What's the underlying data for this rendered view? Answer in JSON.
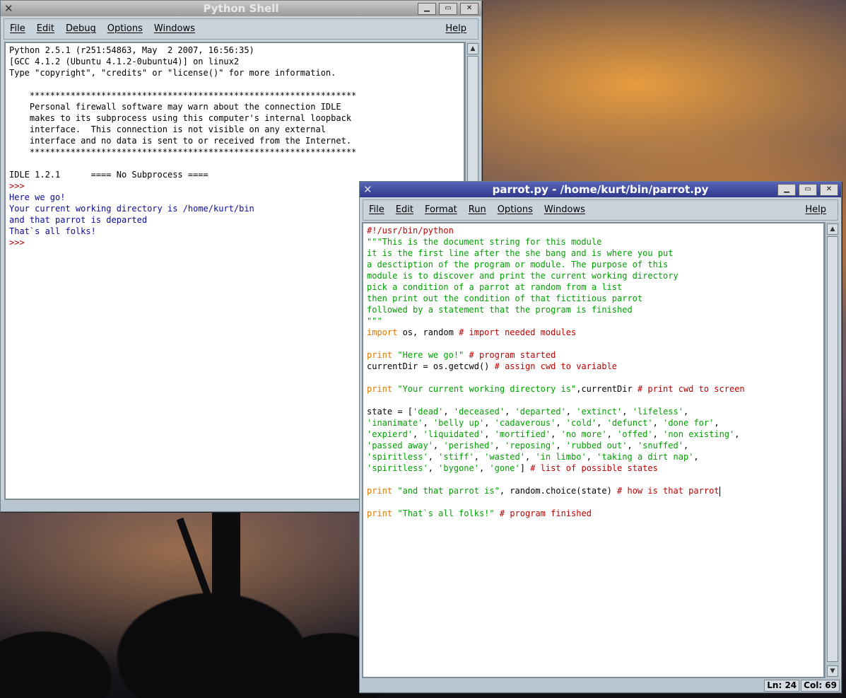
{
  "shell": {
    "title": "Python Shell",
    "menu": [
      "File",
      "Edit",
      "Debug",
      "Options",
      "Windows"
    ],
    "help": "Help",
    "lines": [
      {
        "t": "Python 2.5.1 (r251:54863, May  2 2007, 16:56:35)",
        "c": "norm"
      },
      {
        "t": "[GCC 4.1.2 (Ubuntu 4.1.2-0ubuntu4)] on linux2",
        "c": "norm"
      },
      {
        "t": "Type \"copyright\", \"credits\" or \"license()\" for more information.",
        "c": "norm"
      },
      {
        "t": "",
        "c": "norm"
      },
      {
        "t": "    ****************************************************************",
        "c": "norm"
      },
      {
        "t": "    Personal firewall software may warn about the connection IDLE",
        "c": "norm"
      },
      {
        "t": "    makes to its subprocess using this computer's internal loopback",
        "c": "norm"
      },
      {
        "t": "    interface.  This connection is not visible on any external",
        "c": "norm"
      },
      {
        "t": "    interface and no data is sent to or received from the Internet.",
        "c": "norm"
      },
      {
        "t": "    ****************************************************************",
        "c": "norm"
      },
      {
        "t": "",
        "c": "norm"
      },
      {
        "t": "IDLE 1.2.1      ==== No Subprocess ====",
        "c": "norm"
      },
      {
        "t": ">>> ",
        "c": "prompt"
      },
      {
        "t": "Here we go!",
        "c": "out"
      },
      {
        "t": "Your current working directory is /home/kurt/bin",
        "c": "out"
      },
      {
        "t": "and that parrot is departed",
        "c": "out"
      },
      {
        "t": "That`s all folks!",
        "c": "out"
      },
      {
        "t": ">>> ",
        "c": "prompt"
      }
    ]
  },
  "editor": {
    "title": "parrot.py - /home/kurt/bin/parrot.py",
    "menu": [
      "File",
      "Edit",
      "Format",
      "Run",
      "Options",
      "Windows"
    ],
    "help": "Help",
    "lines": [
      [
        {
          "t": "#!/usr/bin/python",
          "c": "com"
        }
      ],
      [
        {
          "t": "\"\"\"This is the document string for this module",
          "c": "str"
        }
      ],
      [
        {
          "t": "it is the first line after the she bang and is where you put",
          "c": "str"
        }
      ],
      [
        {
          "t": "a desctiption of the program or module. The purpose of this",
          "c": "str"
        }
      ],
      [
        {
          "t": "module is to discover and print the current working directory",
          "c": "str"
        }
      ],
      [
        {
          "t": "pick a condition of a parrot at random from a list",
          "c": "str"
        }
      ],
      [
        {
          "t": "then print out the condition of that fictitious parrot",
          "c": "str"
        }
      ],
      [
        {
          "t": "followed by a statement that the program is finished",
          "c": "str"
        }
      ],
      [
        {
          "t": "\"\"\"",
          "c": "str"
        }
      ],
      [
        {
          "t": "import",
          "c": "kw"
        },
        {
          "t": " os, random ",
          "c": "norm"
        },
        {
          "t": "# import needed modules",
          "c": "com"
        }
      ],
      [
        {
          "t": "",
          "c": "norm"
        }
      ],
      [
        {
          "t": "print",
          "c": "kw"
        },
        {
          "t": " ",
          "c": "norm"
        },
        {
          "t": "\"Here we go!\"",
          "c": "str"
        },
        {
          "t": " ",
          "c": "norm"
        },
        {
          "t": "# program started",
          "c": "com"
        }
      ],
      [
        {
          "t": "currentDir = os.getcwd() ",
          "c": "norm"
        },
        {
          "t": "# assign cwd to variable",
          "c": "com"
        }
      ],
      [
        {
          "t": "",
          "c": "norm"
        }
      ],
      [
        {
          "t": "print",
          "c": "kw"
        },
        {
          "t": " ",
          "c": "norm"
        },
        {
          "t": "\"Your current working directory is\"",
          "c": "str"
        },
        {
          "t": ",currentDir ",
          "c": "norm"
        },
        {
          "t": "# print cwd to screen",
          "c": "com"
        }
      ],
      [
        {
          "t": "",
          "c": "norm"
        }
      ],
      [
        {
          "t": "state = [",
          "c": "norm"
        },
        {
          "t": "'dead'",
          "c": "str"
        },
        {
          "t": ", ",
          "c": "norm"
        },
        {
          "t": "'deceased'",
          "c": "str"
        },
        {
          "t": ", ",
          "c": "norm"
        },
        {
          "t": "'departed'",
          "c": "str"
        },
        {
          "t": ", ",
          "c": "norm"
        },
        {
          "t": "'extinct'",
          "c": "str"
        },
        {
          "t": ", ",
          "c": "norm"
        },
        {
          "t": "'lifeless'",
          "c": "str"
        },
        {
          "t": ",",
          "c": "norm"
        }
      ],
      [
        {
          "t": "'inanimate'",
          "c": "str"
        },
        {
          "t": ", ",
          "c": "norm"
        },
        {
          "t": "'belly up'",
          "c": "str"
        },
        {
          "t": ", ",
          "c": "norm"
        },
        {
          "t": "'cadaverous'",
          "c": "str"
        },
        {
          "t": ", ",
          "c": "norm"
        },
        {
          "t": "'cold'",
          "c": "str"
        },
        {
          "t": ", ",
          "c": "norm"
        },
        {
          "t": "'defunct'",
          "c": "str"
        },
        {
          "t": ", ",
          "c": "norm"
        },
        {
          "t": "'done for'",
          "c": "str"
        },
        {
          "t": ",",
          "c": "norm"
        }
      ],
      [
        {
          "t": "'expierd'",
          "c": "str"
        },
        {
          "t": ", ",
          "c": "norm"
        },
        {
          "t": "'liquidated'",
          "c": "str"
        },
        {
          "t": ", ",
          "c": "norm"
        },
        {
          "t": "'mortified'",
          "c": "str"
        },
        {
          "t": ", ",
          "c": "norm"
        },
        {
          "t": "'no more'",
          "c": "str"
        },
        {
          "t": ", ",
          "c": "norm"
        },
        {
          "t": "'offed'",
          "c": "str"
        },
        {
          "t": ", ",
          "c": "norm"
        },
        {
          "t": "'non existing'",
          "c": "str"
        },
        {
          "t": ",",
          "c": "norm"
        }
      ],
      [
        {
          "t": "'passed away'",
          "c": "str"
        },
        {
          "t": ", ",
          "c": "norm"
        },
        {
          "t": "'perished'",
          "c": "str"
        },
        {
          "t": ", ",
          "c": "norm"
        },
        {
          "t": "'reposing'",
          "c": "str"
        },
        {
          "t": ", ",
          "c": "norm"
        },
        {
          "t": "'rubbed out'",
          "c": "str"
        },
        {
          "t": ", ",
          "c": "norm"
        },
        {
          "t": "'snuffed'",
          "c": "str"
        },
        {
          "t": ",",
          "c": "norm"
        }
      ],
      [
        {
          "t": "'spiritless'",
          "c": "str"
        },
        {
          "t": ", ",
          "c": "norm"
        },
        {
          "t": "'stiff'",
          "c": "str"
        },
        {
          "t": ", ",
          "c": "norm"
        },
        {
          "t": "'wasted'",
          "c": "str"
        },
        {
          "t": ", ",
          "c": "norm"
        },
        {
          "t": "'in limbo'",
          "c": "str"
        },
        {
          "t": ", ",
          "c": "norm"
        },
        {
          "t": "'taking a dirt nap'",
          "c": "str"
        },
        {
          "t": ",",
          "c": "norm"
        }
      ],
      [
        {
          "t": "'spiritless'",
          "c": "str"
        },
        {
          "t": ", ",
          "c": "norm"
        },
        {
          "t": "'bygone'",
          "c": "str"
        },
        {
          "t": ", ",
          "c": "norm"
        },
        {
          "t": "'gone'",
          "c": "str"
        },
        {
          "t": "] ",
          "c": "norm"
        },
        {
          "t": "# list of possible states",
          "c": "com"
        }
      ],
      [
        {
          "t": "",
          "c": "norm"
        }
      ],
      [
        {
          "t": "print",
          "c": "kw"
        },
        {
          "t": " ",
          "c": "norm"
        },
        {
          "t": "\"and that parrot is\"",
          "c": "str"
        },
        {
          "t": ", random.choice(state) ",
          "c": "norm"
        },
        {
          "t": "# how is that parrot",
          "c": "com"
        }
      ],
      [
        {
          "t": "",
          "c": "norm"
        }
      ],
      [
        {
          "t": "print",
          "c": "kw"
        },
        {
          "t": " ",
          "c": "norm"
        },
        {
          "t": "\"That`s all folks!\"",
          "c": "str"
        },
        {
          "t": " ",
          "c": "norm"
        },
        {
          "t": "# program finished",
          "c": "com"
        }
      ]
    ],
    "status": {
      "line": "Ln: 24",
      "col": "Col: 69"
    }
  },
  "icons": {
    "close": "close-icon",
    "minimize": "minimize-icon",
    "maximize": "maximize-icon"
  }
}
